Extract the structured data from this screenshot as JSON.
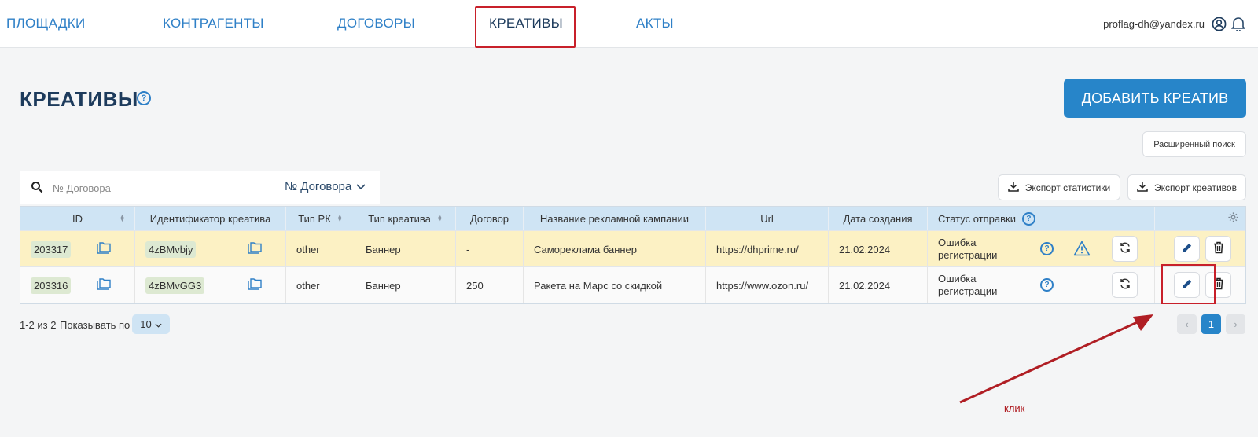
{
  "nav": {
    "items": [
      {
        "label": "ПЛОЩАДКИ"
      },
      {
        "label": "КОНТРАГЕНТЫ"
      },
      {
        "label": "ДОГОВОРЫ"
      },
      {
        "label": "КРЕАТИВЫ"
      },
      {
        "label": "АКТЫ"
      }
    ],
    "active": "КРЕАТИВЫ",
    "user_email": "proflag-dh@yandex.ru"
  },
  "page": {
    "title": "КРЕАТИВЫ",
    "help_glyph": "?",
    "add_button": "ДОБАВИТЬ КРЕАТИВ",
    "advanced_search": "Расширенный поиск"
  },
  "search": {
    "placeholder": "№ Договора",
    "select_value": "№ Договора"
  },
  "exports": {
    "stats": "Экспорт статистики",
    "creatives": "Экспорт креативов"
  },
  "table": {
    "headers": {
      "id": "ID",
      "identifier": "Идентификатор креатива",
      "rk_type": "Тип РК",
      "creative_type": "Тип креатива",
      "contract": "Договор",
      "campaign": "Название рекламной кампании",
      "url": "Url",
      "created": "Дата создания",
      "status": "Статус отправки"
    },
    "rows": [
      {
        "id": "203317",
        "identifier": "4zBMvbjy",
        "rk_type": "other",
        "creative_type": "Баннер",
        "contract": "-",
        "campaign": "Самореклама баннер",
        "url": "https://dhprime.ru/",
        "created": "21.02.2024",
        "status_line1": "Ошибка",
        "status_line2": "регистрации",
        "warning": true
      },
      {
        "id": "203316",
        "identifier": "4zBMvGG3",
        "rk_type": "other",
        "creative_type": "Баннер",
        "contract": "250",
        "campaign": "Ракета на Марс со скидкой",
        "url": "https://www.ozon.ru/",
        "created": "21.02.2024",
        "status_line1": "Ошибка",
        "status_line2": "регистрации",
        "warning": false
      }
    ]
  },
  "footer": {
    "range": "1-2 из 2",
    "per_page_label": "Показывать по",
    "per_page_value": "10",
    "current_page": "1",
    "prev": "‹",
    "next": "›"
  },
  "annotation": {
    "label": "клик"
  },
  "colors": {
    "accent": "#2785c9",
    "nav_link": "#2f80c7",
    "title": "#1d3b5c",
    "highlight": "#c8202a",
    "row_highlight": "#fcf1c4",
    "header_bg": "#cfe4f4"
  }
}
